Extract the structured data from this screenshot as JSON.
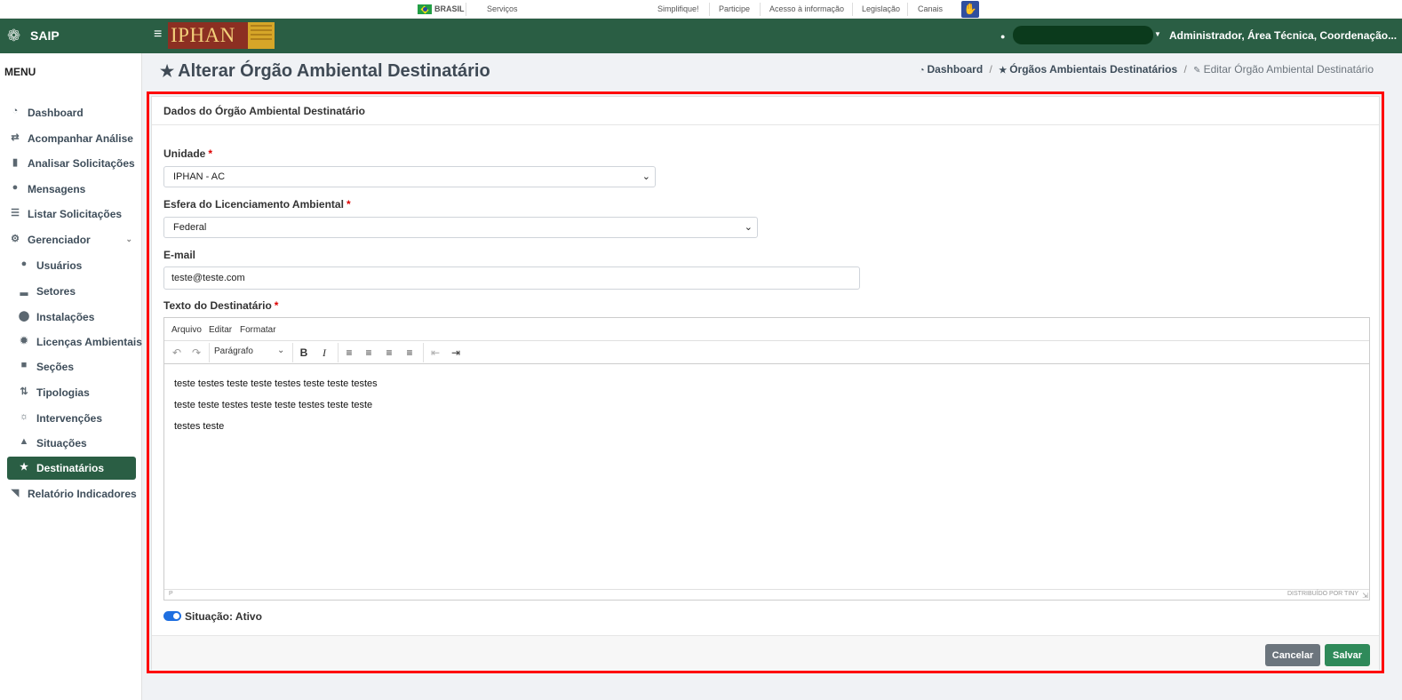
{
  "govbar": {
    "brasil": "BRASIL",
    "servicos": "Serviços",
    "links": [
      "Simplifique!",
      "Participe",
      "Acesso à informação",
      "Legislação",
      "Canais"
    ]
  },
  "header": {
    "app_name": "SAIP",
    "logo_text": "IPHAN",
    "user_role": "Administrador, Área Técnica, Coordenação..."
  },
  "sidebar": {
    "menu_title": "MENU",
    "items": [
      {
        "label": "Dashboard",
        "icon": "dashboard-icon"
      },
      {
        "label": "Acompanhar Análise",
        "icon": "exchange-icon"
      },
      {
        "label": "Analisar Solicitações",
        "icon": "book-icon"
      },
      {
        "label": "Mensagens",
        "icon": "comments-icon"
      },
      {
        "label": "Listar Solicitações",
        "icon": "list-icon"
      },
      {
        "label": "Gerenciador",
        "icon": "cogs-icon"
      },
      {
        "label": "Usuários",
        "icon": "users-icon"
      },
      {
        "label": "Setores",
        "icon": "industry-icon"
      },
      {
        "label": "Instalações",
        "icon": "circle-icon"
      },
      {
        "label": "Licenças Ambientais",
        "icon": "certificate-icon"
      },
      {
        "label": "Seções",
        "icon": "square-icon"
      },
      {
        "label": "Tipologias",
        "icon": "random-icon"
      },
      {
        "label": "Intervenções",
        "icon": "sun-icon"
      },
      {
        "label": "Situações",
        "icon": "bell-icon"
      },
      {
        "label": "Destinatários",
        "icon": "star-icon"
      },
      {
        "label": "Relatório Indicadores",
        "icon": "area-chart-icon"
      }
    ]
  },
  "page": {
    "title": "Alterar Órgão Ambiental Destinatário",
    "breadcrumb": [
      "Dashboard",
      "Órgãos Ambientais Destinatários",
      "Editar Órgão Ambiental Destinatário"
    ]
  },
  "form": {
    "card_title": "Dados do Órgão Ambiental Destinatário",
    "unidade_label": "Unidade",
    "unidade_value": "IPHAN - AC",
    "esfera_label": "Esfera do Licenciamento Ambiental",
    "esfera_value": "Federal",
    "email_label": "E-mail",
    "email_value": "teste@teste.com",
    "texto_label": "Texto do Destinatário",
    "required_mark": "*",
    "editor": {
      "menus": [
        "Arquivo",
        "Editar",
        "Formatar"
      ],
      "block_format": "Parágrafo",
      "content": [
        "teste testes teste teste testes teste teste testes",
        "teste teste testes teste teste testes teste teste",
        "testes teste"
      ],
      "status_path": "P",
      "powered_by": "DISTRIBUÍDO POR TINY"
    },
    "situacao_label": "Situação: Ativo",
    "situacao_active": true,
    "cancel_label": "Cancelar",
    "save_label": "Salvar"
  },
  "colors": {
    "header": "#2a5e44",
    "active_nav": "#2a5e44",
    "highlight": "#ff0000",
    "save": "#2f8a5a",
    "cancel": "#6c757d"
  }
}
